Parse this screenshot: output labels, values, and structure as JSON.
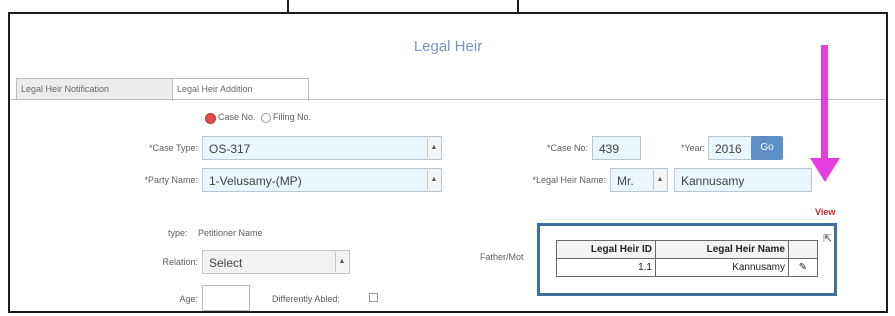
{
  "page": {
    "title": "Legal Heir"
  },
  "tabs": [
    {
      "label": "Legal Heir Notification",
      "active": false
    },
    {
      "label": "Legal Heir Addition",
      "active": true
    }
  ],
  "form": {
    "radio_case_no": "Case No.",
    "radio_filing_no": "Filing No.",
    "case_type_label": "*Case Type:",
    "case_type_value": "OS-317",
    "case_no_label": "*Case No:",
    "case_no_value": "439",
    "year_label": "*Year:",
    "year_value": "2016",
    "go_label": "Go",
    "party_name_label": "*Party Name:",
    "party_name_value": "1-Velusamy-(MP)",
    "legal_heir_name_label": "*Legal Heir Name:",
    "title_value": "Mr.",
    "legal_heir_name_value": "Kannusamy",
    "view_label": "View",
    "type_label": "type:",
    "type_value": "Petitioner Name",
    "relation_label": "Relation:",
    "relation_value": "Select",
    "age_label": "Age:",
    "age_value": "",
    "differently_abled_label": "Differently Abled:",
    "father_label": "Father/Mot"
  },
  "popup": {
    "columns": [
      "Legal Heir ID",
      "Legal Heir Name"
    ],
    "rows": [
      {
        "id": "1.1",
        "name": "Kannusamy"
      }
    ]
  },
  "colors": {
    "title": "#7a93c6",
    "field_bg": "#eaf6fb",
    "go_button": "#5d8fc7",
    "annotation_arrow": "#e63ddf",
    "popup_border": "#3e6f9d",
    "view_link": "#d32424"
  }
}
